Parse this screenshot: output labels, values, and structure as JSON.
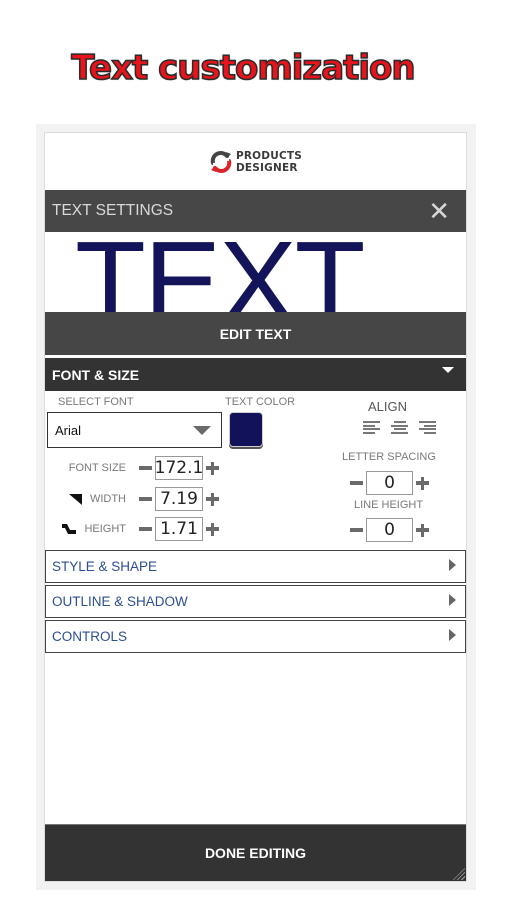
{
  "promo": {
    "title": "Text customization"
  },
  "logo": {
    "line1": "PRODUCTS",
    "line2": "DESIGNER"
  },
  "settings": {
    "title": "TEXT SETTINGS",
    "close_icon": "close-icon",
    "preview_text": "TEXT",
    "edit_button": "EDIT TEXT"
  },
  "font_size_section": {
    "title": "FONT & SIZE",
    "expanded": true,
    "select_font_label": "SELECT FONT",
    "font_value": "Arial",
    "text_color_label": "TEXT COLOR",
    "text_color": "#12125a",
    "align_label": "ALIGN",
    "align_options": [
      "left",
      "center",
      "right"
    ],
    "font_size_label": "FONT SIZE",
    "font_size_value": "172.1",
    "width_label": "WIDTH",
    "width_value": "7.19",
    "height_label": "HEIGHT",
    "height_value": "1.71",
    "letter_spacing_label": "LETTER SPACING",
    "letter_spacing_value": "0",
    "line_height_label": "LINE HEIGHT",
    "line_height_value": "0"
  },
  "accordions": [
    {
      "label": "STYLE & SHAPE"
    },
    {
      "label": "OUTLINE & SHADOW"
    },
    {
      "label": "CONTROLS"
    }
  ],
  "footer": {
    "done_button": "DONE EDITING"
  },
  "colors": {
    "promo_red": "#e8141b",
    "header_bg": "#474747",
    "section_bg": "#333333",
    "accordion_text": "#2d4f8f",
    "logo_red": "#d9242a"
  }
}
